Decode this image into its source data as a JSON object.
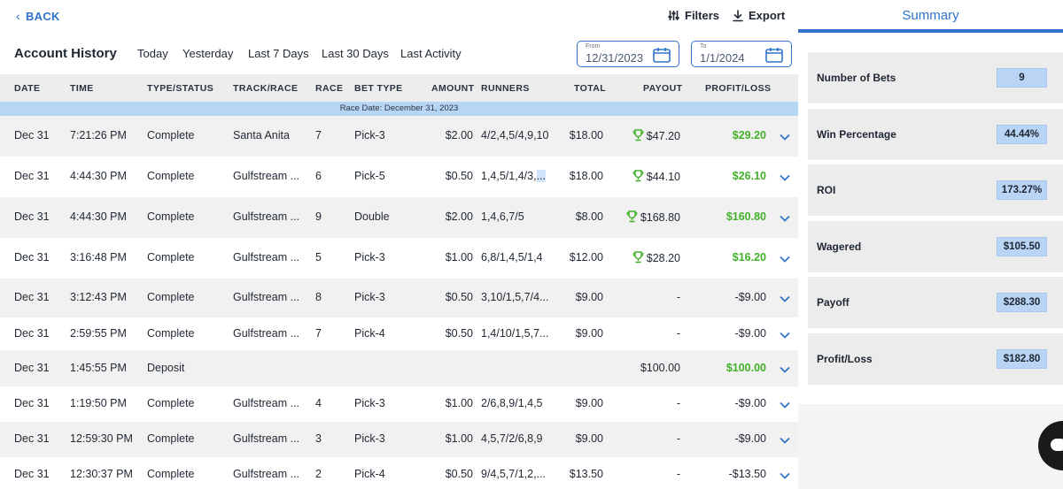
{
  "nav": {
    "back_label": "BACK",
    "filters_label": "Filters",
    "export_label": "Export"
  },
  "page_title": "Account History",
  "ranges": [
    "Today",
    "Yesterday",
    "Last 7 Days",
    "Last 30 Days",
    "Last Activity"
  ],
  "date_from": {
    "label": "From",
    "value": "12/31/2023"
  },
  "date_to": {
    "label": "To",
    "value": "1/1/2024"
  },
  "columns": [
    "DATE",
    "TIME",
    "TYPE/STATUS",
    "TRACK/RACE",
    "RACE",
    "BET TYPE",
    "AMOUNT",
    "RUNNERS",
    "TOTAL",
    "PAYOUT",
    "PROFIT/LOSS"
  ],
  "group_label": "Race Date: December 31, 2023",
  "rows": [
    {
      "date": "Dec 31",
      "time": "7:21:26 PM",
      "status": "Complete",
      "track": "Santa Anita",
      "race": "7",
      "bet_type": "Pick-3",
      "amount": "$2.00",
      "runners": "4/2,4,5/4,9,10",
      "total": "$18.00",
      "payout": "$47.20",
      "winner": true,
      "pl": "$29.20",
      "positive": true
    },
    {
      "date": "Dec 31",
      "time": "4:44:30 PM",
      "status": "Complete",
      "track": "Gulfstream ...",
      "race": "6",
      "bet_type": "Pick-5",
      "amount": "$0.50",
      "runners": "1,4,5/1,4/3,",
      "runners_sel": "...",
      "total": "$18.00",
      "payout": "$44.10",
      "winner": true,
      "pl": "$26.10",
      "positive": true
    },
    {
      "date": "Dec 31",
      "time": "4:44:30 PM",
      "status": "Complete",
      "track": "Gulfstream ...",
      "race": "9",
      "bet_type": "Double",
      "amount": "$2.00",
      "runners": "1,4,6,7/5",
      "total": "$8.00",
      "payout": "$168.80",
      "winner": true,
      "pl": "$160.80",
      "positive": true
    },
    {
      "date": "Dec 31",
      "time": "3:16:48 PM",
      "status": "Complete",
      "track": "Gulfstream ...",
      "race": "5",
      "bet_type": "Pick-3",
      "amount": "$1.00",
      "runners": "6,8/1,4,5/1,4",
      "total": "$12.00",
      "payout": "$28.20",
      "winner": true,
      "pl": "$16.20",
      "positive": true
    },
    {
      "date": "Dec 31",
      "time": "3:12:43 PM",
      "status": "Complete",
      "track": "Gulfstream ...",
      "race": "8",
      "bet_type": "Pick-3",
      "amount": "$0.50",
      "runners": "3,10/1,5,7/4...",
      "total": "$9.00",
      "payout": "-",
      "winner": false,
      "pl": "-$9.00",
      "positive": false
    },
    {
      "date": "Dec 31",
      "time": "2:59:55 PM",
      "status": "Complete",
      "track": "Gulfstream ...",
      "race": "7",
      "bet_type": "Pick-4",
      "amount": "$0.50",
      "runners": "1,4/10/1,5,7...",
      "total": "$9.00",
      "payout": "-",
      "winner": false,
      "pl": "-$9.00",
      "positive": false
    },
    {
      "date": "Dec 31",
      "time": "1:45:55 PM",
      "status": "Deposit",
      "track": "",
      "race": "",
      "bet_type": "",
      "amount": "",
      "runners": "",
      "total": "",
      "payout": "$100.00",
      "winner": false,
      "pl": "$100.00",
      "positive": true
    },
    {
      "date": "Dec 31",
      "time": "1:19:50 PM",
      "status": "Complete",
      "track": "Gulfstream ...",
      "race": "4",
      "bet_type": "Pick-3",
      "amount": "$1.00",
      "runners": "2/6,8,9/1,4,5",
      "total": "$9.00",
      "payout": "-",
      "winner": false,
      "pl": "-$9.00",
      "positive": false
    },
    {
      "date": "Dec 31",
      "time": "12:59:30 PM",
      "status": "Complete",
      "track": "Gulfstream ...",
      "race": "3",
      "bet_type": "Pick-3",
      "amount": "$1.00",
      "runners": "4,5,7/2/6,8,9",
      "total": "$9.00",
      "payout": "-",
      "winner": false,
      "pl": "-$9.00",
      "positive": false
    },
    {
      "date": "Dec 31",
      "time": "12:30:37 PM",
      "status": "Complete",
      "track": "Gulfstream ...",
      "race": "2",
      "bet_type": "Pick-4",
      "amount": "$0.50",
      "runners": "9/4,5,7/1,2,...",
      "total": "$13.50",
      "payout": "-",
      "winner": false,
      "pl": "-$13.50",
      "positive": false
    }
  ],
  "summary": {
    "tab_label": "Summary",
    "stats": [
      {
        "label": "Number of Bets",
        "value": "9"
      },
      {
        "label": "Win Percentage",
        "value": "44.44%"
      },
      {
        "label": "ROI",
        "value": "173.27%"
      },
      {
        "label": "Wagered",
        "value": "$105.50"
      },
      {
        "label": "Payoff",
        "value": "$288.30"
      },
      {
        "label": "Profit/Loss",
        "value": "$182.80"
      }
    ]
  },
  "colors": {
    "accent": "#2f73c9",
    "positive": "#43b02a",
    "highlight": "#b7d5f5",
    "trophy": "#43b02a"
  },
  "icons": {
    "back": "chevron-left-icon",
    "filters": "sliders-icon",
    "export": "download-icon",
    "calendar": "calendar-icon",
    "trophy": "trophy-icon",
    "expand": "chevron-down-icon"
  }
}
